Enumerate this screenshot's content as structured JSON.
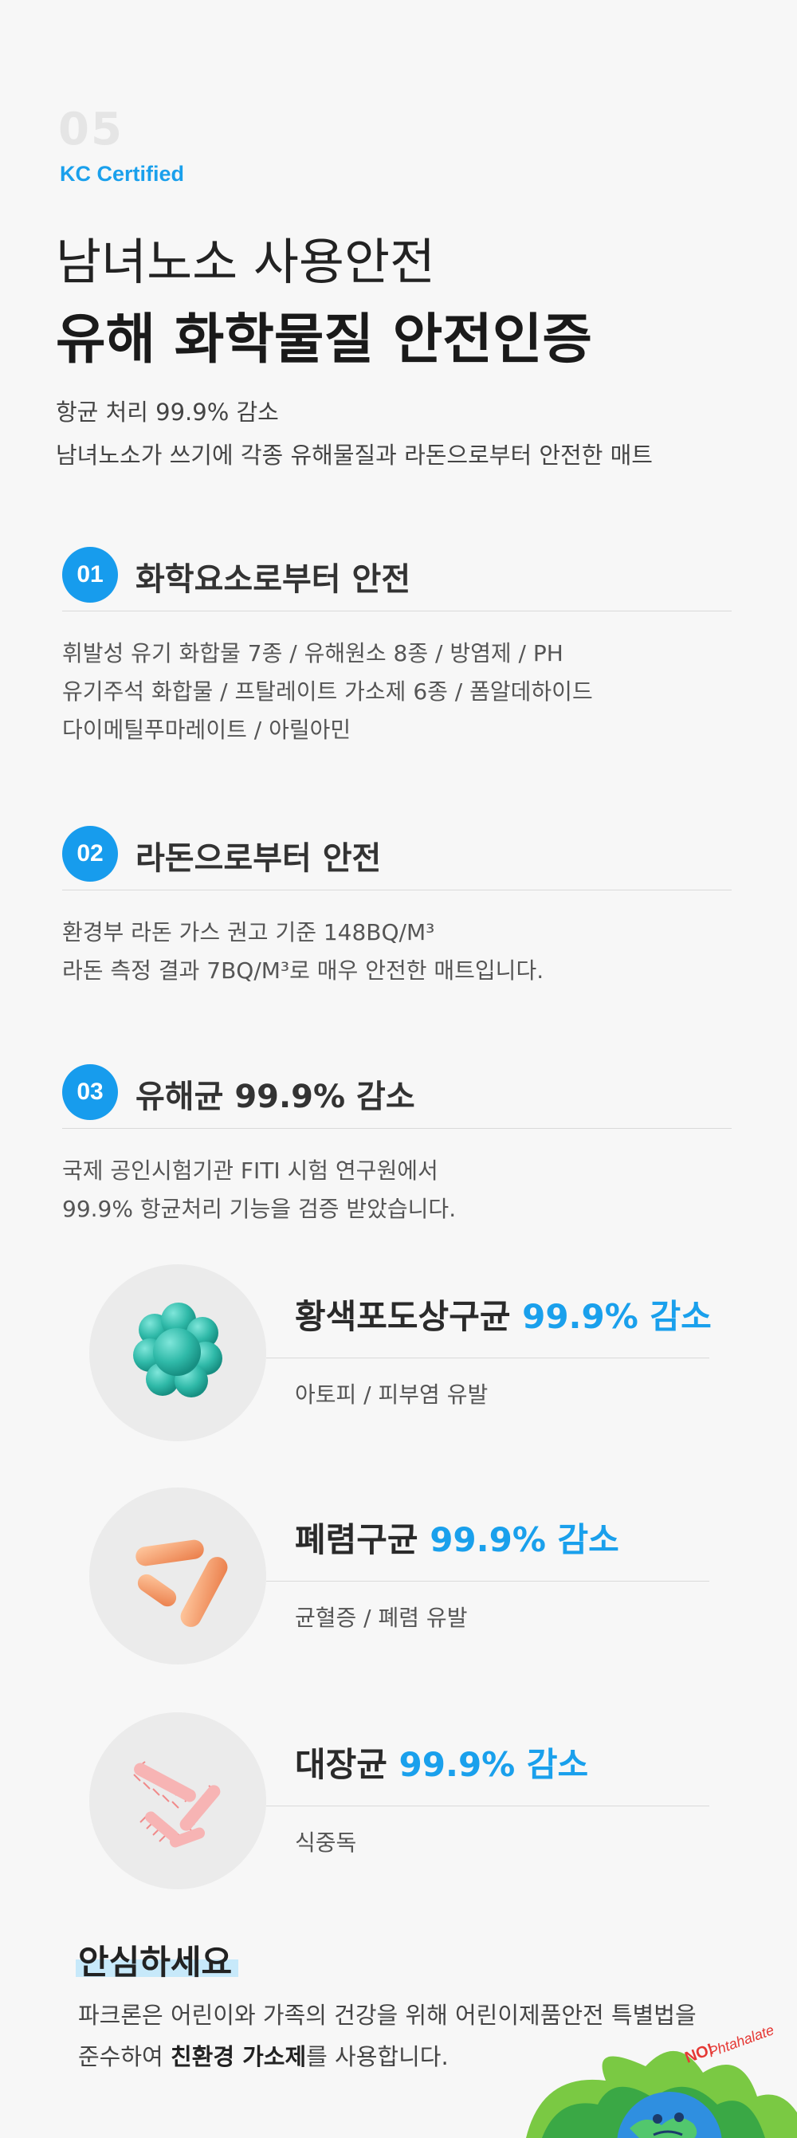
{
  "section": {
    "number": "05",
    "label": "KC Certified",
    "title_line1": "남녀노소 사용안전",
    "title_line2": "유해 화학물질 안전인증",
    "intro_line1": "항균 처리 99.9% 감소",
    "intro_line2": "남녀노소가 쓰기에 각종 유해물질과 라돈으로부터 안전한 매트"
  },
  "items": [
    {
      "num": "01",
      "title": "화학요소로부터 안전",
      "lines": [
        "휘발성 유기 화합물 7종 / 유해원소 8종 / 방염제 / PH",
        "유기주석 화합물 / 프탈레이트 가소제 6종 / 폼알데하이드",
        "다이메틸푸마레이트 / 아릴아민"
      ]
    },
    {
      "num": "02",
      "title": "라돈으로부터 안전",
      "lines": [
        "환경부 라돈 가스 권고 기준 148BQ/M³",
        "라돈 측정 결과 7BQ/M³로 매우 안전한 매트입니다."
      ]
    },
    {
      "num": "03",
      "title": "유해균 99.9% 감소",
      "lines": [
        "국제 공인시험기관 FITI 시험 연구원에서",
        "99.9% 항균처리 기능을 검증 받았습니다."
      ]
    }
  ],
  "bacteria": [
    {
      "name": "황색포도상구균",
      "reduction": "99.9% 감소",
      "effect": "아토피 / 피부염 유발",
      "icon": "staphylococcus-icon"
    },
    {
      "name": "폐렴구균",
      "reduction": "99.9% 감소",
      "effect": "균혈증 / 폐렴 유발",
      "icon": "pneumococcus-icon"
    },
    {
      "name": "대장균",
      "reduction": "99.9% 감소",
      "effect": "식중독",
      "icon": "e-coli-icon"
    }
  ],
  "relief": {
    "title": "안심하세요",
    "line1": "파크론은 어린이와 가족의 건강을 위해 어린이제품안전 특별법을",
    "line2_pre": "준수하여 ",
    "line2_bold": "친환경 가소제",
    "line2_post": "를 사용합니다."
  },
  "badge": {
    "no": "NO!",
    "word": "Phtahalate",
    "icon": "no-phthalate-earth-icon"
  },
  "colors": {
    "accent": "#1aa0ec",
    "background": "#f7f7f7",
    "number_watermark": "#e5e5e5"
  }
}
